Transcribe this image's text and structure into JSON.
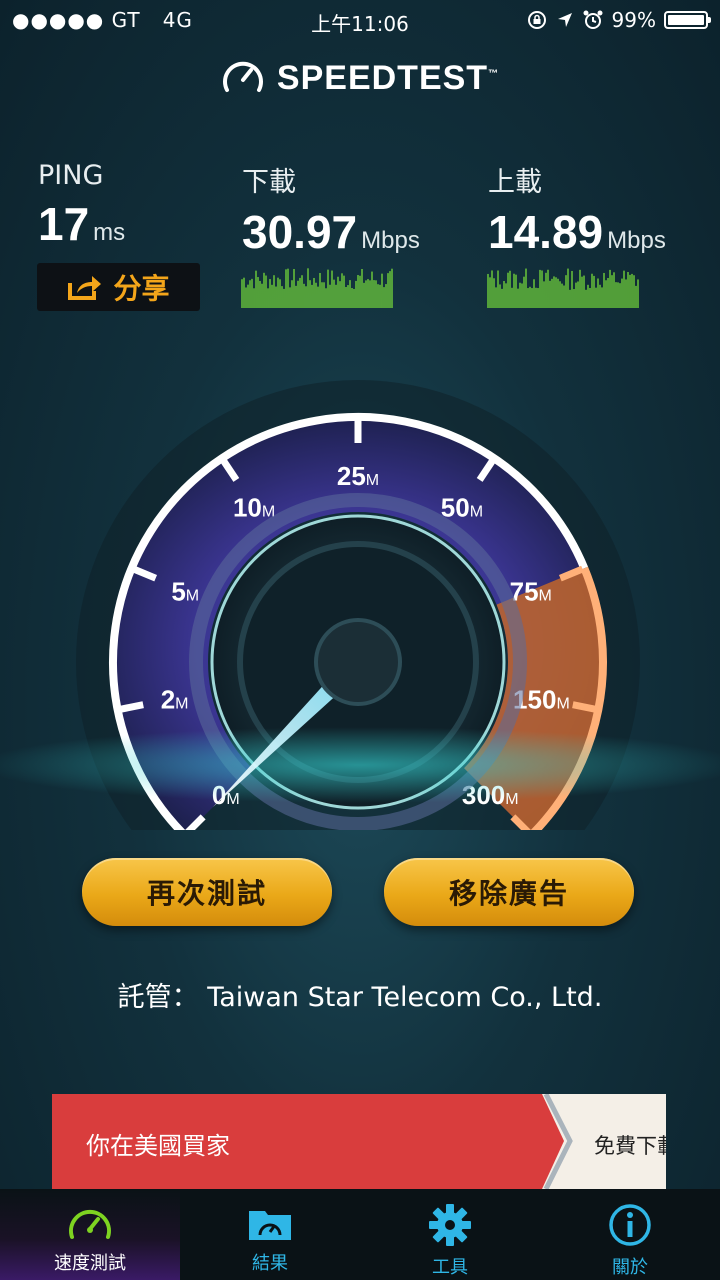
{
  "status_bar": {
    "carrier": "●●●●● GT",
    "network": "4G",
    "time": "上午11:06",
    "battery": "99%",
    "battery_level": 0.99
  },
  "header": {
    "logo_text": "SPEEDTEST",
    "trademark": "™"
  },
  "results": {
    "ping": {
      "label": "PING",
      "value": "17",
      "unit": "ms"
    },
    "download": {
      "label": "下載",
      "value": "30.97",
      "unit": "Mbps"
    },
    "upload": {
      "label": "上載",
      "value": "14.89",
      "unit": "Mbps"
    },
    "share_label": "分享"
  },
  "gauge": {
    "ticks": [
      {
        "value": "0",
        "unit": "M"
      },
      {
        "value": "2",
        "unit": "M"
      },
      {
        "value": "5",
        "unit": "M"
      },
      {
        "value": "10",
        "unit": "M"
      },
      {
        "value": "25",
        "unit": "M"
      },
      {
        "value": "50",
        "unit": "M"
      },
      {
        "value": "75",
        "unit": "M"
      },
      {
        "value": "150",
        "unit": "M"
      },
      {
        "value": "300",
        "unit": "M"
      }
    ],
    "needle_value_mbps": 0
  },
  "actions": {
    "retest_label": "再次測試",
    "remove_ads_label": "移除廣告"
  },
  "host": {
    "label": "託管：",
    "name": "Taiwan Star Telecom Co., Ltd."
  },
  "ad": {
    "text": "你在美國買家",
    "cta": "免費下載"
  },
  "tabs": [
    {
      "label": "速度測試",
      "icon": "speedometer-icon",
      "active": true
    },
    {
      "label": "結果",
      "icon": "results-folder-icon",
      "active": false
    },
    {
      "label": "工具",
      "icon": "gear-icon",
      "active": false
    },
    {
      "label": "關於",
      "icon": "info-icon",
      "active": false
    }
  ],
  "colors": {
    "accent_orange": "#f3a51a",
    "tab_blue": "#2fb6e6",
    "active_tab_green": "#7ed321",
    "ad_red": "#d93d3d"
  }
}
